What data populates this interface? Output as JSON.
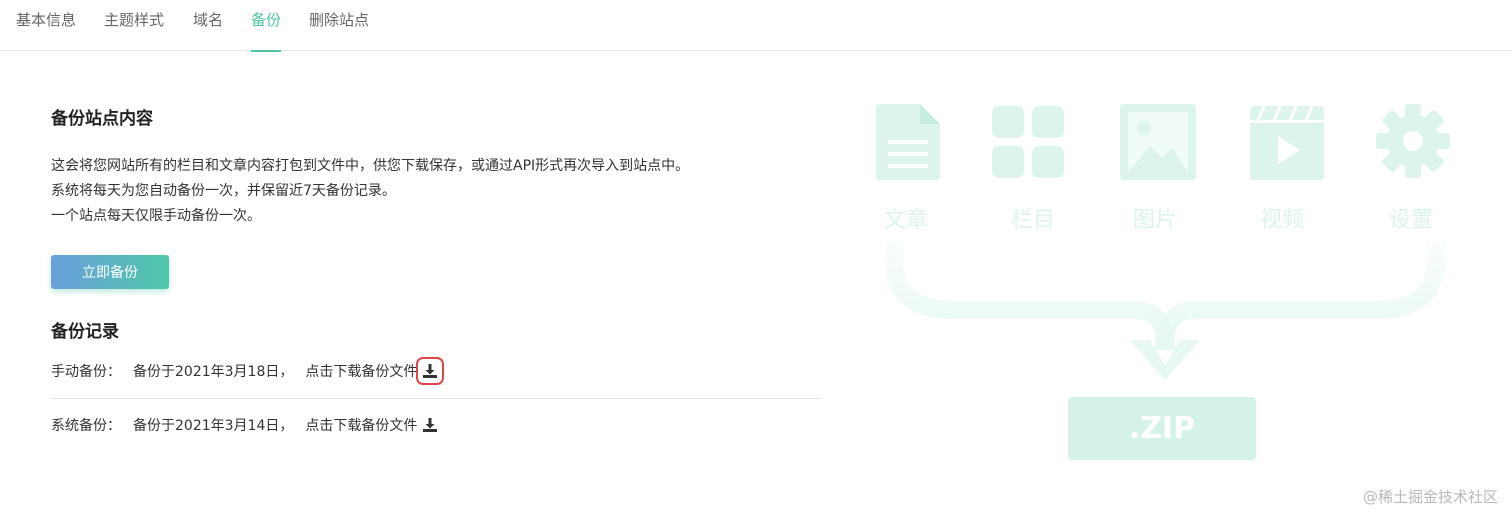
{
  "tabs": [
    {
      "label": "基本信息",
      "active": false
    },
    {
      "label": "主题样式",
      "active": false
    },
    {
      "label": "域名",
      "active": false
    },
    {
      "label": "备份",
      "active": true
    },
    {
      "label": "删除站点",
      "active": false
    }
  ],
  "backup": {
    "title": "备份站点内容",
    "description": [
      "这会将您网站所有的栏目和文章内容打包到文件中，供您下载保存，或通过API形式再次导入到站点中。",
      "系统将每天为您自动备份一次，并保留近7天备份记录。",
      "一个站点每天仅限手动备份一次。"
    ],
    "button_label": "立即备份"
  },
  "records": {
    "title": "备份记录",
    "items": [
      {
        "label": "手动备份：",
        "info": "备份于2021年3月18日，",
        "link": "点击下载备份文件",
        "icon": "download-icon"
      },
      {
        "label": "系统备份：",
        "info": "备份于2021年3月14日，",
        "link": "点击下载备份文件",
        "icon": "download-icon"
      }
    ]
  },
  "illustration": {
    "items": [
      {
        "label": "文章",
        "icon": "document-icon"
      },
      {
        "label": "栏目",
        "icon": "grid-icon"
      },
      {
        "label": "图片",
        "icon": "image-icon"
      },
      {
        "label": "视频",
        "icon": "video-icon"
      },
      {
        "label": "设置",
        "icon": "gear-icon"
      }
    ],
    "zip_label": ".ZIP",
    "color": "#d4f2e8"
  },
  "watermark": "@稀土掘金技术社区",
  "colors": {
    "accent": "#4ec3a3",
    "highlight": "#e04545"
  }
}
